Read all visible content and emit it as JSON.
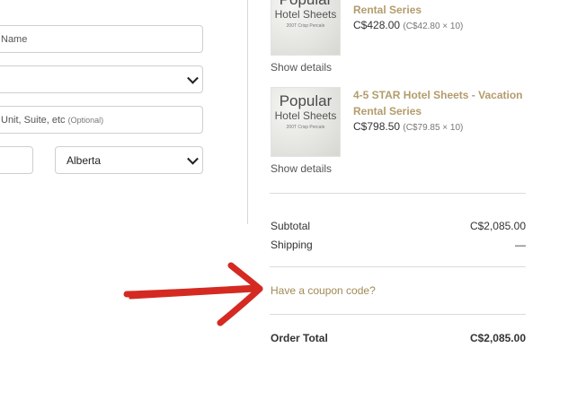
{
  "form": {
    "name_placeholder": "Name",
    "state_value": "",
    "address2_placeholder": "Unit, Suite, etc",
    "address2_optional": "(Optional)",
    "city_value": "",
    "province_value": "Alberta"
  },
  "cart": {
    "items": [
      {
        "name_line1": "",
        "name_line2": "Rental Series",
        "price": "C$428.00",
        "unit_price": "(C$42.80 × 10)",
        "show_details": "Show details",
        "thumb": {
          "line1": "Popular",
          "line2": "Hotel Sheets",
          "line3": "200T Crisp Percale"
        }
      },
      {
        "name_line1": "4-5 STAR Hotel Sheets - Vacation",
        "name_line2": "Rental Series",
        "price": "C$798.50",
        "unit_price": "(C$79.85 × 10)",
        "show_details": "Show details",
        "thumb": {
          "line1": "Popular",
          "line2": "Hotel Sheets",
          "line3": "200T Crisp Percale"
        }
      }
    ]
  },
  "summary": {
    "subtotal_label": "Subtotal",
    "subtotal_value": "C$2,085.00",
    "shipping_label": "Shipping",
    "shipping_value": "—",
    "coupon_link": "Have a coupon code?",
    "total_label": "Order Total",
    "total_value": "C$2,085.00"
  },
  "colors": {
    "accent_gold": "#b39c6c",
    "annotation_arrow": "#d42a22"
  }
}
